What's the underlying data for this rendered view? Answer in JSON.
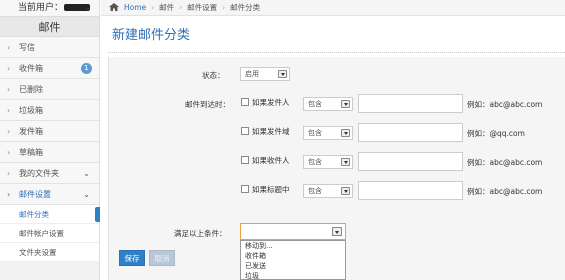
{
  "user": {
    "label": "当前用户："
  },
  "sidebar": {
    "header": "邮件",
    "items": [
      {
        "label": "写信"
      },
      {
        "label": "收件箱",
        "badge": "1"
      },
      {
        "label": "已删除"
      },
      {
        "label": "垃圾箱"
      },
      {
        "label": "发件箱"
      },
      {
        "label": "草稿箱"
      },
      {
        "label": "我的文件夹"
      },
      {
        "label": "邮件设置"
      }
    ],
    "sub_items": [
      {
        "label": "邮件分类"
      },
      {
        "label": "邮件帐户设置"
      },
      {
        "label": "文件夹设置"
      }
    ]
  },
  "breadcrumb": {
    "home": "Home",
    "level1": "邮件",
    "level2": "邮件设置",
    "current": "邮件分类"
  },
  "page": {
    "title": "新建邮件分类"
  },
  "form": {
    "status_label": "状态：",
    "status_value": "启用",
    "arrival_label": "邮件到达时：",
    "rules": [
      {
        "check_label": "如果发件人",
        "match": "包含",
        "hint": "例如：abc@abc.com"
      },
      {
        "check_label": "如果发件域",
        "match": "包含",
        "hint": "例如：@qq.com"
      },
      {
        "check_label": "如果收件人",
        "match": "包含",
        "hint": "例如：abc@abc.com"
      },
      {
        "check_label": "如果标题中",
        "match": "包含",
        "hint": "例如：abc@abc.com"
      }
    ],
    "condition_label": "满足以上条件：",
    "condition_options": [
      "移动到...",
      "收件箱",
      "已发送",
      "垃圾"
    ]
  },
  "buttons": {
    "save": "保存",
    "cancel": "取消"
  },
  "colors": {
    "accent": "#2f80c7",
    "title": "#2f6fb5",
    "badge": "#5b9bd5",
    "focus_border": "#e8a24e"
  }
}
